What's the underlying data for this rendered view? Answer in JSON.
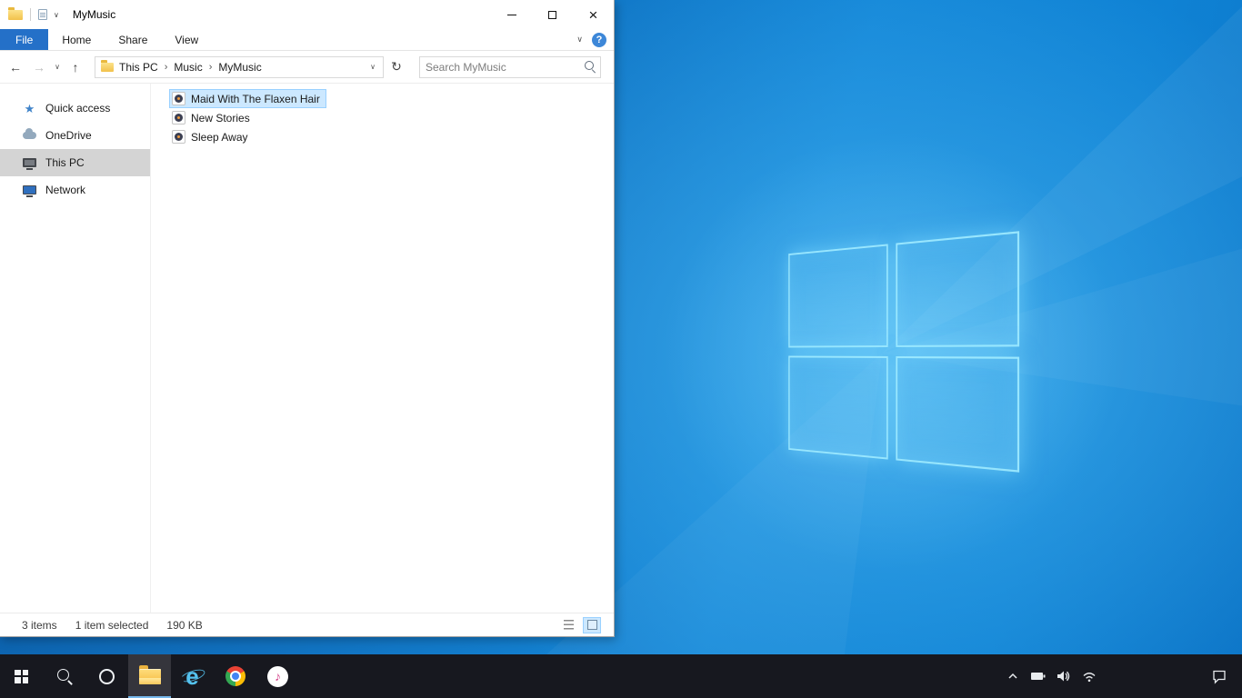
{
  "explorer": {
    "title": "MyMusic",
    "tabs": [
      "File",
      "Home",
      "Share",
      "View"
    ],
    "breadcrumb": [
      "This PC",
      "Music",
      "MyMusic"
    ],
    "search_placeholder": "Search MyMusic",
    "sidebar": [
      {
        "label": "Quick access",
        "icon": "star-icon"
      },
      {
        "label": "OneDrive",
        "icon": "cloud-icon"
      },
      {
        "label": "This PC",
        "icon": "monitor-icon",
        "selected": true
      },
      {
        "label": "Network",
        "icon": "network-icon"
      }
    ],
    "files": [
      {
        "name": "Maid With The Flaxen Hair",
        "icon": "music-file-icon",
        "selected": true
      },
      {
        "name": "New Stories",
        "icon": "music-file-icon",
        "selected": false
      },
      {
        "name": "Sleep Away",
        "icon": "music-file-icon",
        "selected": false
      }
    ],
    "status": {
      "count": "3 items",
      "selection": "1 item selected",
      "size": "190 KB"
    }
  },
  "icons": {
    "back": "←",
    "forward": "→",
    "up": "↑",
    "refresh": "↻",
    "chevron_down": "∨",
    "crumb_chevron": "›",
    "help": "?",
    "close": "×",
    "star": "★",
    "note": "♪",
    "ie_e": "e"
  },
  "colors": {
    "file_tab_blue": "#2470c8",
    "selection_bg": "#cce8ff",
    "selection_border": "#99d1ff",
    "sidebar_selected_bg": "#d4d4d4",
    "taskbar_bg": "#17181f",
    "taskbar_active_underline": "#76b9ed",
    "wallpaper_blue": "#1386d7",
    "logo_glow_blue": "#82d7ff"
  }
}
